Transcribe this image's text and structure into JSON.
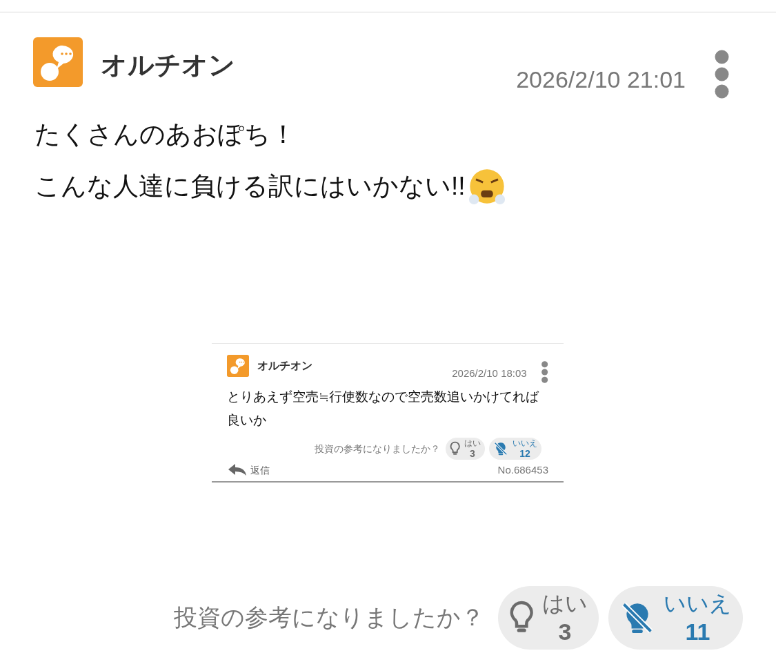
{
  "post": {
    "author": "オルチオン",
    "date": "2026/2/10 21:01",
    "body_lines": [
      "たくさんのあおぽち！",
      "こんな人達に負ける訳にはいかない!!"
    ],
    "quoted_post": {
      "author": "オルチオン",
      "date": "2026/2/10 18:03",
      "body": "とりあえず空売≒行使数なので空売数追いかけてれば良いか",
      "vote_question": "投資の参考になりましたか？",
      "votes": [
        {
          "kind": "yes",
          "label": "はい",
          "count": "3",
          "selected": false
        },
        {
          "kind": "no",
          "label": "いいえ",
          "count": "12",
          "selected": true
        }
      ],
      "reply": "返信",
      "number": "No.686453"
    },
    "vote_question": "投資の参考になりましたか？",
    "votes": [
      {
        "kind": "yes",
        "label": "はい",
        "count": "3",
        "selected": false
      },
      {
        "kind": "no",
        "label": "いいえ",
        "count": "11",
        "selected": true
      }
    ]
  }
}
